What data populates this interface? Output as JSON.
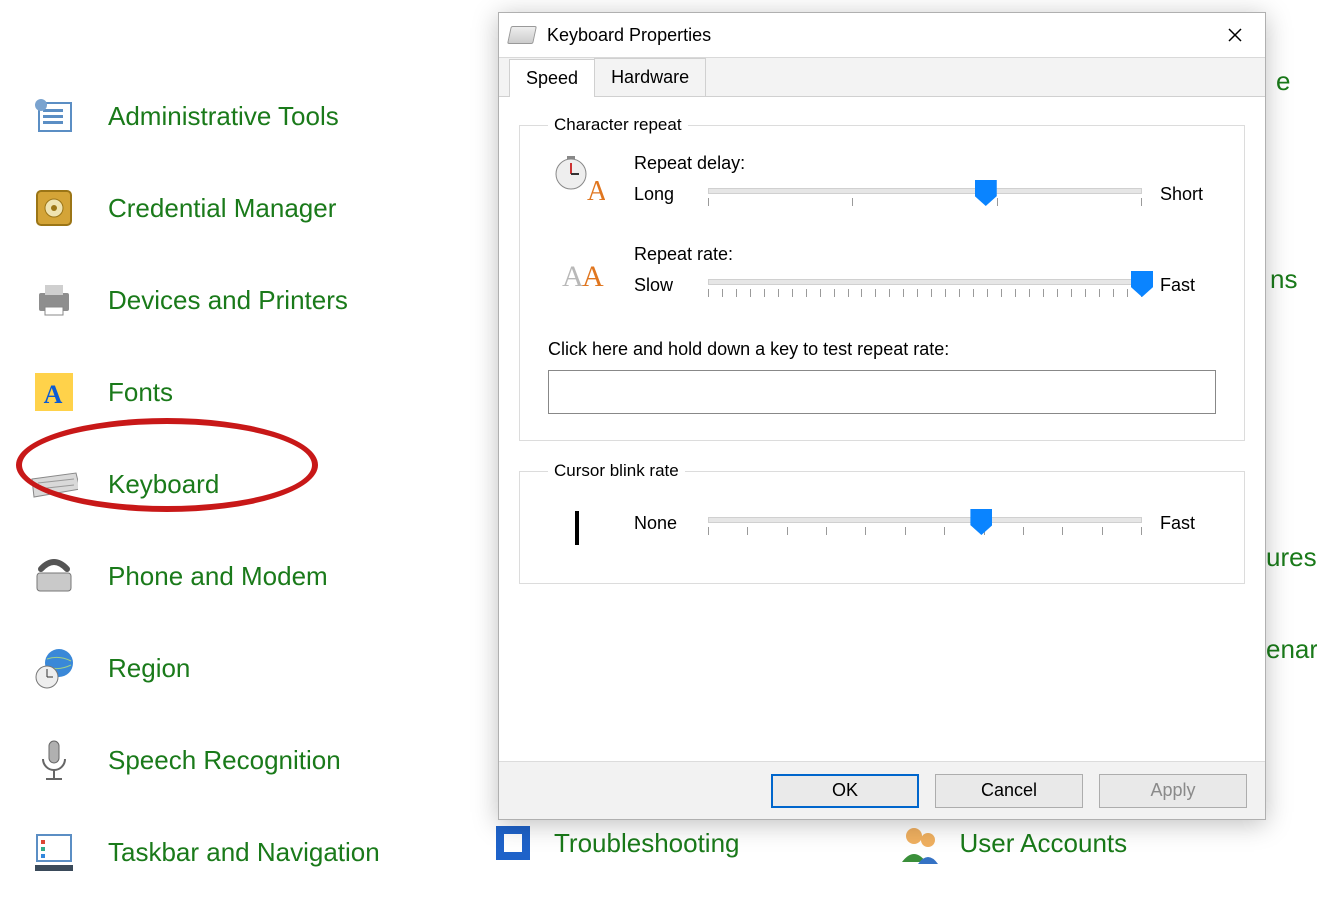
{
  "control_panel": {
    "items": [
      {
        "label": "Administrative Tools"
      },
      {
        "label": "Credential Manager"
      },
      {
        "label": "Devices and Printers"
      },
      {
        "label": "Fonts"
      },
      {
        "label": "Keyboard"
      },
      {
        "label": "Phone and Modem"
      },
      {
        "label": "Region"
      },
      {
        "label": "Speech Recognition"
      },
      {
        "label": "Taskbar and Navigation"
      }
    ],
    "highlighted_index": 4
  },
  "background_peeks": {
    "right_fragment_1": "ns",
    "right_fragment_2": "ures",
    "right_fragment_3": "enar",
    "right_fragment_4": "e",
    "troubleshooting": "Troubleshooting",
    "user_accounts": "User Accounts"
  },
  "dialog": {
    "title": "Keyboard Properties",
    "tabs": {
      "speed": "Speed",
      "hardware": "Hardware",
      "active": "speed"
    },
    "groups": {
      "char_repeat": {
        "legend": "Character repeat",
        "repeat_delay": {
          "label": "Repeat delay:",
          "left": "Long",
          "right": "Short",
          "ticks": 4,
          "value_percent": 64
        },
        "repeat_rate": {
          "label": "Repeat rate:",
          "left": "Slow",
          "right": "Fast",
          "ticks": 32,
          "value_percent": 100
        },
        "test_label": "Click here and hold down a key to test repeat rate:",
        "test_value": ""
      },
      "blink": {
        "legend": "Cursor blink rate",
        "left": "None",
        "right": "Fast",
        "ticks": 12,
        "value_percent": 63
      }
    },
    "buttons": {
      "ok": "OK",
      "cancel": "Cancel",
      "apply": "Apply"
    }
  }
}
